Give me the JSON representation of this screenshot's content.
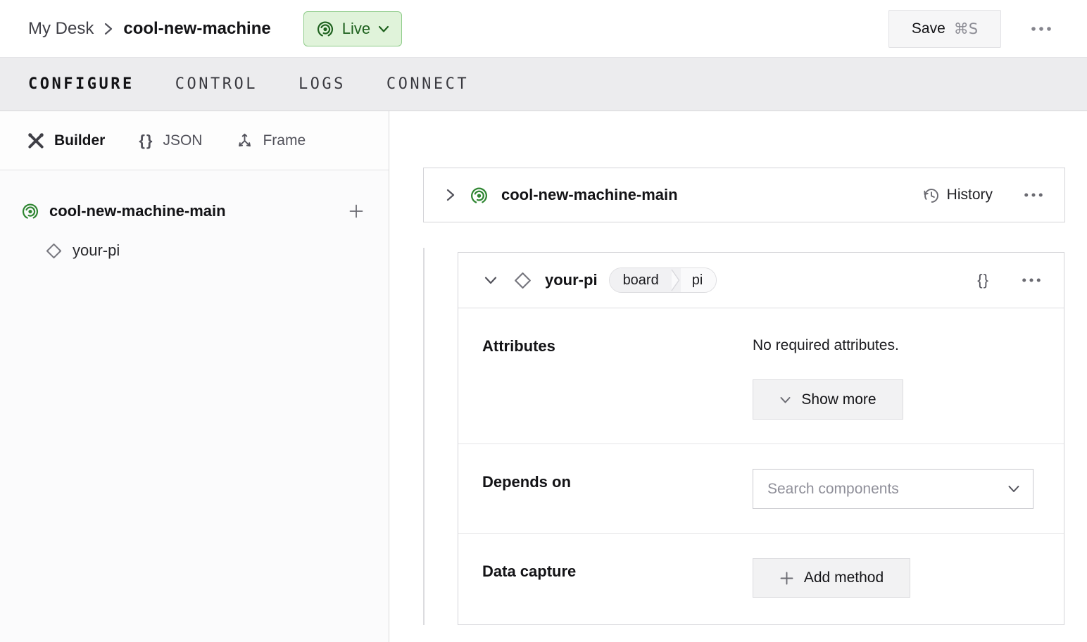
{
  "header": {
    "breadcrumb": {
      "root": "My Desk",
      "current": "cool-new-machine"
    },
    "machine_status": {
      "label": "Live"
    },
    "save": {
      "label": "Save",
      "shortcut": "⌘S"
    }
  },
  "nav_tabs": [
    {
      "label": "CONFIGURE",
      "active": true
    },
    {
      "label": "CONTROL",
      "active": false
    },
    {
      "label": "LOGS",
      "active": false
    },
    {
      "label": "CONNECT",
      "active": false
    }
  ],
  "sidebar": {
    "mode_tabs": [
      {
        "label": "Builder",
        "icon": "tools-icon",
        "active": true
      },
      {
        "label": "JSON",
        "icon": "braces-icon",
        "active": false
      },
      {
        "label": "Frame",
        "icon": "frame-axes-icon",
        "active": false
      }
    ],
    "tree": {
      "part": {
        "label": "cool-new-machine-main",
        "icon": "live-part-icon",
        "add_action": "+"
      },
      "component": {
        "label": "your-pi",
        "icon": "diamond-icon"
      }
    }
  },
  "main": {
    "part_card": {
      "title": "cool-new-machine-main",
      "history_label": "History"
    },
    "component_card": {
      "title": "your-pi",
      "badge": {
        "api": "board",
        "model": "pi"
      },
      "attributes": {
        "label": "Attributes",
        "note": "No required attributes.",
        "show_more_label": "Show more"
      },
      "depends_on": {
        "label": "Depends on",
        "placeholder": "Search components"
      },
      "data_capture": {
        "label": "Data capture",
        "add_method_label": "Add method"
      }
    }
  },
  "colors": {
    "accent_green": "#2f8632",
    "live_badge_bg": "#e0f3da",
    "live_badge_border": "#8fcc8a",
    "live_text": "#1e611e",
    "tab_bar_bg": "#ececee",
    "card_border": "#d4d4d8",
    "muted_text": "#8f8f99"
  }
}
